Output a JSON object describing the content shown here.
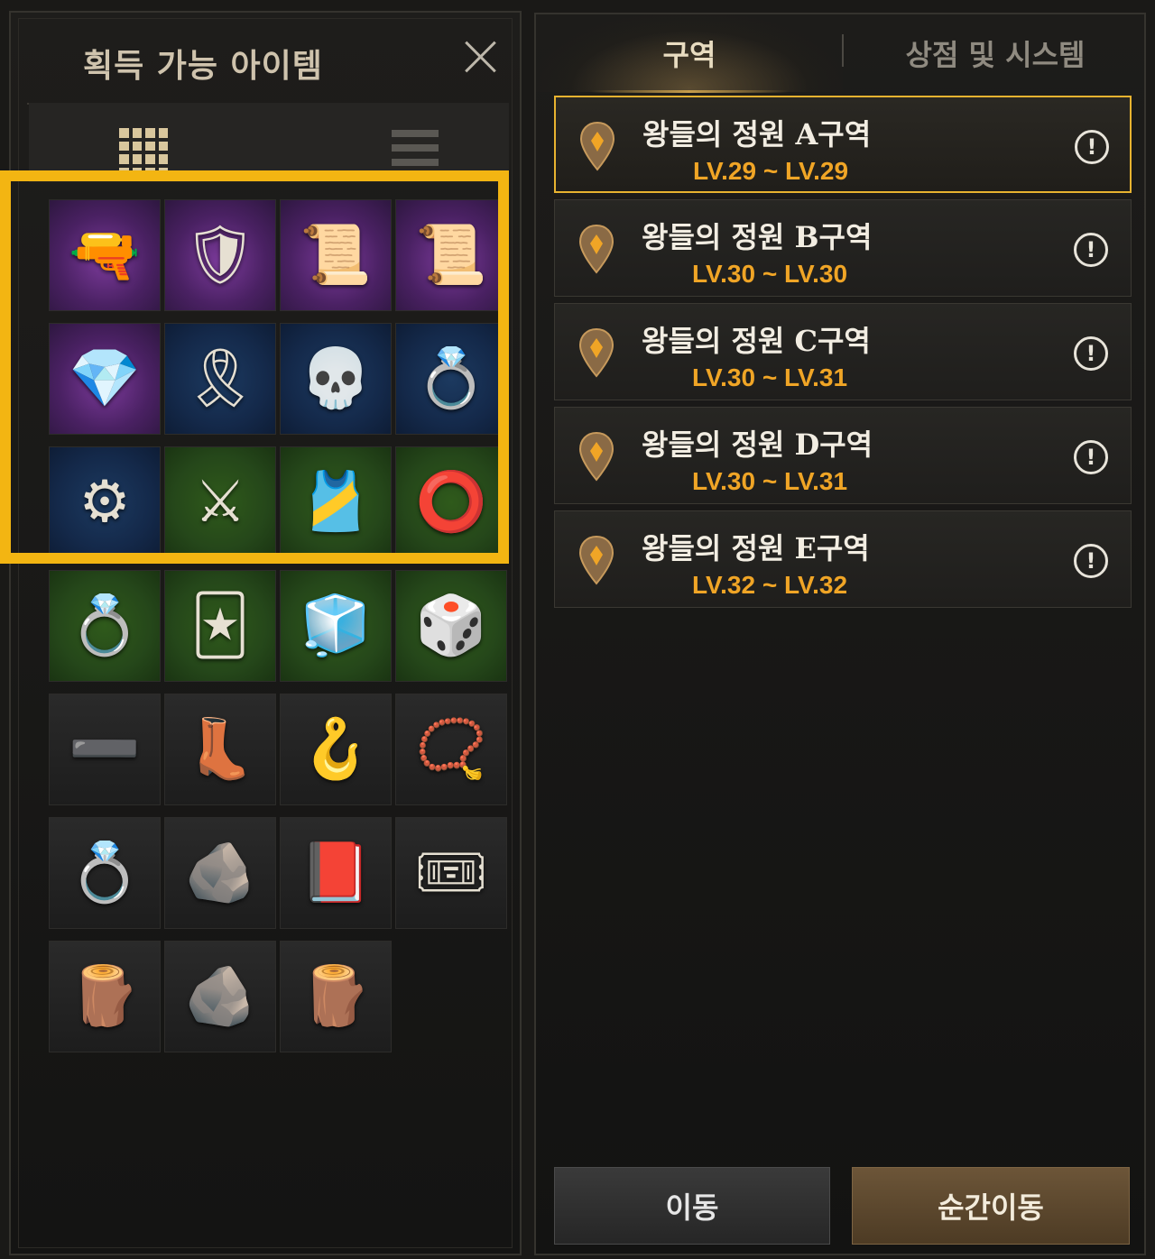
{
  "left_panel": {
    "title": "획득 가능 아이템",
    "close_icon": "close-icon",
    "view_modes": [
      "grid-view-icon",
      "list-view-icon"
    ],
    "items": [
      {
        "name": "flintlock-pistol-icon",
        "glyph": "🔫",
        "rarity": "purple"
      },
      {
        "name": "plate-armor-icon",
        "glyph": "🛡",
        "rarity": "purple"
      },
      {
        "name": "helmet-scroll-icon",
        "glyph": "📜",
        "rarity": "purple"
      },
      {
        "name": "necklace-scroll-icon",
        "glyph": "📜",
        "rarity": "purple"
      },
      {
        "name": "blue-crystal-icon",
        "glyph": "💎",
        "rarity": "purple"
      },
      {
        "name": "leather-belt-icon",
        "glyph": "🎗",
        "rarity": "blue"
      },
      {
        "name": "skull-pendant-icon",
        "glyph": "💀",
        "rarity": "blue"
      },
      {
        "name": "emerald-ring-icon",
        "glyph": "💍",
        "rarity": "blue"
      },
      {
        "name": "ancient-relic-icon",
        "glyph": "⚙",
        "rarity": "blue"
      },
      {
        "name": "longsword-icon",
        "glyph": "⚔",
        "rarity": "green"
      },
      {
        "name": "plated-belt-icon",
        "glyph": "🎽",
        "rarity": "green"
      },
      {
        "name": "ornate-earring-icon",
        "glyph": "⭕",
        "rarity": "green"
      },
      {
        "name": "ruby-ring-icon",
        "glyph": "💍",
        "rarity": "green"
      },
      {
        "name": "green-card-icon",
        "glyph": "🃏",
        "rarity": "green"
      },
      {
        "name": "white-crystal-icon",
        "glyph": "🧊",
        "rarity": "green"
      },
      {
        "name": "stone-die-icon",
        "glyph": "🎲",
        "rarity": "green"
      },
      {
        "name": "green-belt-icon",
        "glyph": "➖",
        "rarity": "gray"
      },
      {
        "name": "green-boots-icon",
        "glyph": "👢",
        "rarity": "gray"
      },
      {
        "name": "silver-earring-icon",
        "glyph": "🪝",
        "rarity": "gray"
      },
      {
        "name": "silver-necklace-icon",
        "glyph": "📿",
        "rarity": "gray"
      },
      {
        "name": "silver-ring-icon",
        "glyph": "💍",
        "rarity": "gray"
      },
      {
        "name": "stone-pendant-icon",
        "glyph": "🪨",
        "rarity": "gray"
      },
      {
        "name": "purple-book-icon",
        "glyph": "📕",
        "rarity": "gray"
      },
      {
        "name": "gold-ticket-icon",
        "glyph": "🎟",
        "rarity": "gray"
      },
      {
        "name": "wood-plank-icon",
        "glyph": "🪵",
        "rarity": "gray"
      },
      {
        "name": "ore-pile-icon",
        "glyph": "🪨",
        "rarity": "gray"
      },
      {
        "name": "wood-block-icon",
        "glyph": "🪵",
        "rarity": "gray"
      }
    ]
  },
  "right_panel": {
    "tabs": {
      "zone": "구역",
      "shop": "상점 및 시스템"
    },
    "zones": [
      {
        "name": "왕들의 정원 A구역",
        "level": "LV.29 ~ LV.29",
        "selected": true
      },
      {
        "name": "왕들의 정원 B구역",
        "level": "LV.30 ~ LV.30",
        "selected": false
      },
      {
        "name": "왕들의 정원 C구역",
        "level": "LV.30 ~ LV.31",
        "selected": false
      },
      {
        "name": "왕들의 정원 D구역",
        "level": "LV.30 ~ LV.31",
        "selected": false
      },
      {
        "name": "왕들의 정원 E구역",
        "level": "LV.32 ~ LV.32",
        "selected": false
      }
    ],
    "info_glyph": "!",
    "buttons": {
      "move": "이동",
      "teleport": "순간이동"
    }
  },
  "colors": {
    "highlight": "#f3b512",
    "level_text": "#f0a526",
    "selected_border": "#e8b330"
  }
}
